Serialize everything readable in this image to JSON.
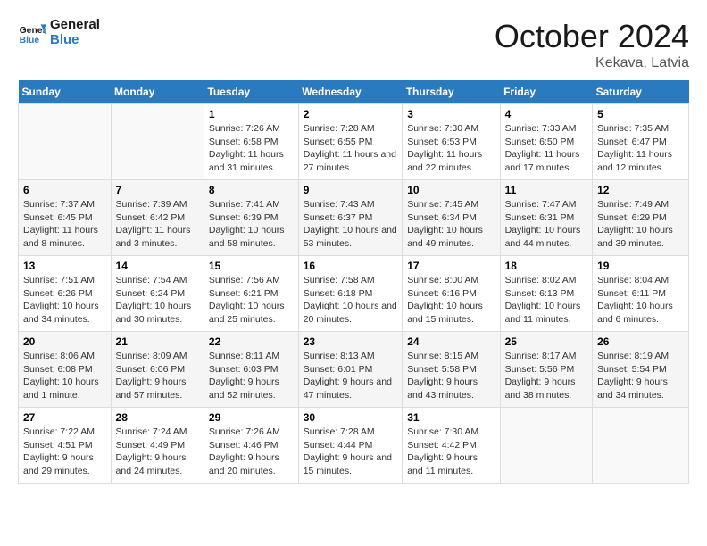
{
  "header": {
    "logo_line1": "General",
    "logo_line2": "Blue",
    "month": "October 2024",
    "location": "Kekava, Latvia"
  },
  "weekdays": [
    "Sunday",
    "Monday",
    "Tuesday",
    "Wednesday",
    "Thursday",
    "Friday",
    "Saturday"
  ],
  "weeks": [
    [
      {
        "day": "",
        "content": ""
      },
      {
        "day": "",
        "content": ""
      },
      {
        "day": "1",
        "content": "Sunrise: 7:26 AM\nSunset: 6:58 PM\nDaylight: 11 hours and 31 minutes."
      },
      {
        "day": "2",
        "content": "Sunrise: 7:28 AM\nSunset: 6:55 PM\nDaylight: 11 hours and 27 minutes."
      },
      {
        "day": "3",
        "content": "Sunrise: 7:30 AM\nSunset: 6:53 PM\nDaylight: 11 hours and 22 minutes."
      },
      {
        "day": "4",
        "content": "Sunrise: 7:33 AM\nSunset: 6:50 PM\nDaylight: 11 hours and 17 minutes."
      },
      {
        "day": "5",
        "content": "Sunrise: 7:35 AM\nSunset: 6:47 PM\nDaylight: 11 hours and 12 minutes."
      }
    ],
    [
      {
        "day": "6",
        "content": "Sunrise: 7:37 AM\nSunset: 6:45 PM\nDaylight: 11 hours and 8 minutes."
      },
      {
        "day": "7",
        "content": "Sunrise: 7:39 AM\nSunset: 6:42 PM\nDaylight: 11 hours and 3 minutes."
      },
      {
        "day": "8",
        "content": "Sunrise: 7:41 AM\nSunset: 6:39 PM\nDaylight: 10 hours and 58 minutes."
      },
      {
        "day": "9",
        "content": "Sunrise: 7:43 AM\nSunset: 6:37 PM\nDaylight: 10 hours and 53 minutes."
      },
      {
        "day": "10",
        "content": "Sunrise: 7:45 AM\nSunset: 6:34 PM\nDaylight: 10 hours and 49 minutes."
      },
      {
        "day": "11",
        "content": "Sunrise: 7:47 AM\nSunset: 6:31 PM\nDaylight: 10 hours and 44 minutes."
      },
      {
        "day": "12",
        "content": "Sunrise: 7:49 AM\nSunset: 6:29 PM\nDaylight: 10 hours and 39 minutes."
      }
    ],
    [
      {
        "day": "13",
        "content": "Sunrise: 7:51 AM\nSunset: 6:26 PM\nDaylight: 10 hours and 34 minutes."
      },
      {
        "day": "14",
        "content": "Sunrise: 7:54 AM\nSunset: 6:24 PM\nDaylight: 10 hours and 30 minutes."
      },
      {
        "day": "15",
        "content": "Sunrise: 7:56 AM\nSunset: 6:21 PM\nDaylight: 10 hours and 25 minutes."
      },
      {
        "day": "16",
        "content": "Sunrise: 7:58 AM\nSunset: 6:18 PM\nDaylight: 10 hours and 20 minutes."
      },
      {
        "day": "17",
        "content": "Sunrise: 8:00 AM\nSunset: 6:16 PM\nDaylight: 10 hours and 15 minutes."
      },
      {
        "day": "18",
        "content": "Sunrise: 8:02 AM\nSunset: 6:13 PM\nDaylight: 10 hours and 11 minutes."
      },
      {
        "day": "19",
        "content": "Sunrise: 8:04 AM\nSunset: 6:11 PM\nDaylight: 10 hours and 6 minutes."
      }
    ],
    [
      {
        "day": "20",
        "content": "Sunrise: 8:06 AM\nSunset: 6:08 PM\nDaylight: 10 hours and 1 minute."
      },
      {
        "day": "21",
        "content": "Sunrise: 8:09 AM\nSunset: 6:06 PM\nDaylight: 9 hours and 57 minutes."
      },
      {
        "day": "22",
        "content": "Sunrise: 8:11 AM\nSunset: 6:03 PM\nDaylight: 9 hours and 52 minutes."
      },
      {
        "day": "23",
        "content": "Sunrise: 8:13 AM\nSunset: 6:01 PM\nDaylight: 9 hours and 47 minutes."
      },
      {
        "day": "24",
        "content": "Sunrise: 8:15 AM\nSunset: 5:58 PM\nDaylight: 9 hours and 43 minutes."
      },
      {
        "day": "25",
        "content": "Sunrise: 8:17 AM\nSunset: 5:56 PM\nDaylight: 9 hours and 38 minutes."
      },
      {
        "day": "26",
        "content": "Sunrise: 8:19 AM\nSunset: 5:54 PM\nDaylight: 9 hours and 34 minutes."
      }
    ],
    [
      {
        "day": "27",
        "content": "Sunrise: 7:22 AM\nSunset: 4:51 PM\nDaylight: 9 hours and 29 minutes."
      },
      {
        "day": "28",
        "content": "Sunrise: 7:24 AM\nSunset: 4:49 PM\nDaylight: 9 hours and 24 minutes."
      },
      {
        "day": "29",
        "content": "Sunrise: 7:26 AM\nSunset: 4:46 PM\nDaylight: 9 hours and 20 minutes."
      },
      {
        "day": "30",
        "content": "Sunrise: 7:28 AM\nSunset: 4:44 PM\nDaylight: 9 hours and 15 minutes."
      },
      {
        "day": "31",
        "content": "Sunrise: 7:30 AM\nSunset: 4:42 PM\nDaylight: 9 hours and 11 minutes."
      },
      {
        "day": "",
        "content": ""
      },
      {
        "day": "",
        "content": ""
      }
    ]
  ]
}
